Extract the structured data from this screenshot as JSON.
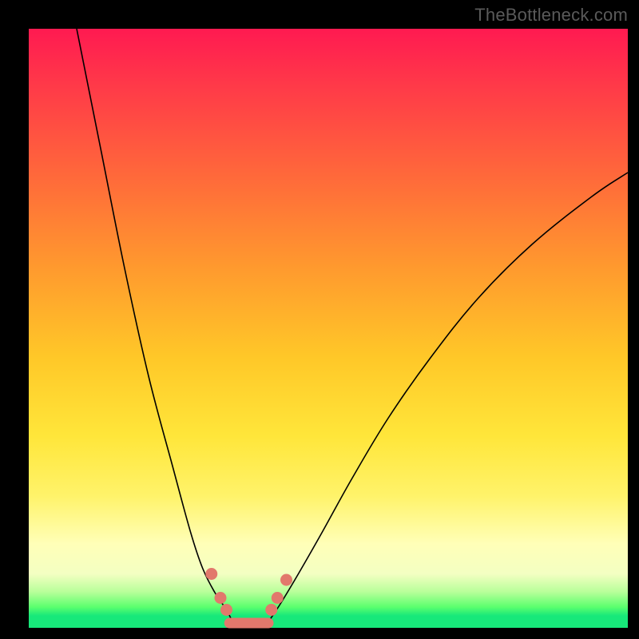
{
  "watermark": "TheBottleneck.com",
  "chart_data": {
    "type": "line",
    "title": "",
    "xlabel": "",
    "ylabel": "",
    "xlim": [
      0,
      100
    ],
    "ylim": [
      0,
      100
    ],
    "grid": false,
    "legend": false,
    "series": [
      {
        "name": "left-branch",
        "x": [
          8,
          12,
          16,
          20,
          24,
          27,
          29,
          31,
          33,
          34
        ],
        "y": [
          100,
          80,
          60,
          42,
          27,
          16,
          10,
          6,
          3,
          1
        ]
      },
      {
        "name": "right-branch",
        "x": [
          40,
          42,
          45,
          49,
          54,
          60,
          67,
          75,
          84,
          94,
          100
        ],
        "y": [
          1,
          4,
          9,
          16,
          25,
          35,
          45,
          55,
          64,
          72,
          76
        ]
      }
    ],
    "markers": [
      {
        "name": "dot",
        "x": 30.5,
        "y": 9
      },
      {
        "name": "dot",
        "x": 32,
        "y": 5
      },
      {
        "name": "dot",
        "x": 33,
        "y": 3
      },
      {
        "name": "dot",
        "x": 40.5,
        "y": 3
      },
      {
        "name": "dot",
        "x": 41.5,
        "y": 5
      },
      {
        "name": "dot",
        "x": 43,
        "y": 8
      }
    ],
    "bottom_segment": {
      "x0": 33.5,
      "x1": 40,
      "y": 0.8
    },
    "background_gradient": {
      "top": "#ff1a51",
      "mid": "#ffe63a",
      "bottom": "#17e87a"
    }
  }
}
